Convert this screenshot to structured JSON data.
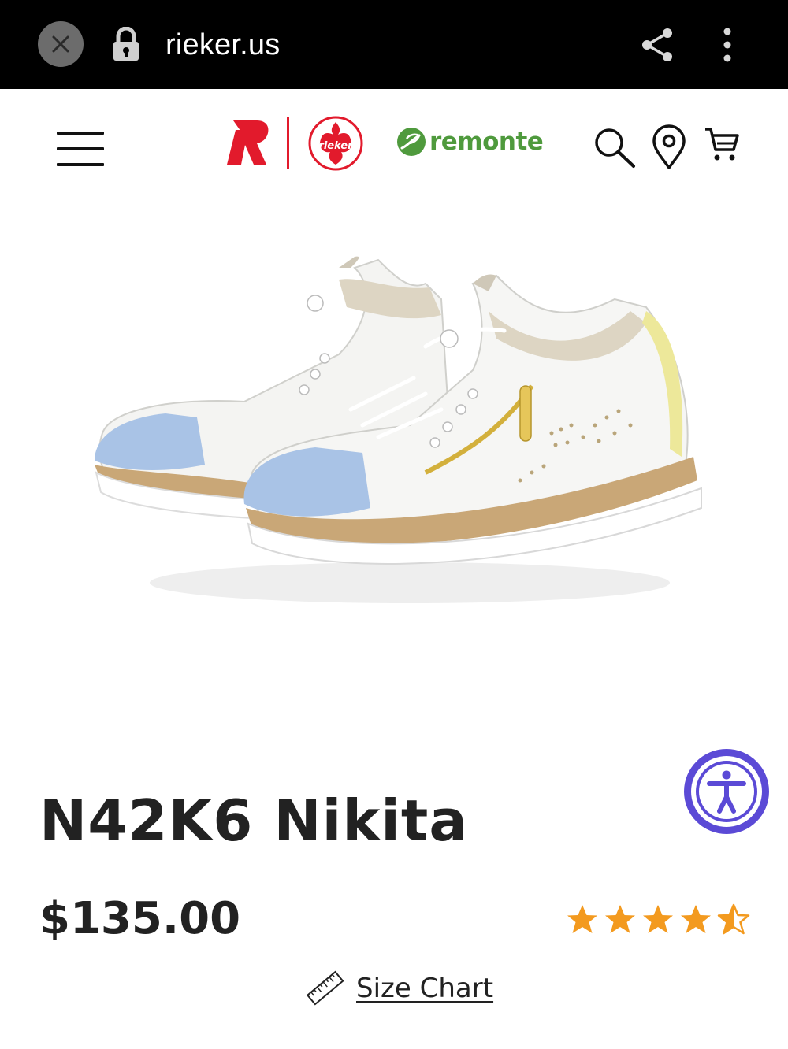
{
  "browser": {
    "url": "rieker.us",
    "icons": {
      "close": "close-icon",
      "lock": "lock-icon",
      "share": "share-icon",
      "more": "more-vert-icon"
    }
  },
  "header": {
    "logos": {
      "r_mark": "R",
      "rieker": "rieker",
      "remonte": "remonte"
    },
    "icons": {
      "menu": "hamburger-menu-icon",
      "search": "search-icon",
      "store_locator": "location-pin-icon",
      "cart": "cart-icon"
    },
    "colors": {
      "brand_red": "#e21a2c",
      "remonte_green": "#4f9a3d"
    }
  },
  "product": {
    "name": "N42K6 Nikita",
    "price": "$135.00",
    "rating": 4.5,
    "rating_max": 5,
    "size_chart_label": "Size Chart",
    "colors": {
      "star": "#f39a1f"
    }
  },
  "accessibility": {
    "icon": "accessibility-icon",
    "color": "#5b4ad6"
  }
}
